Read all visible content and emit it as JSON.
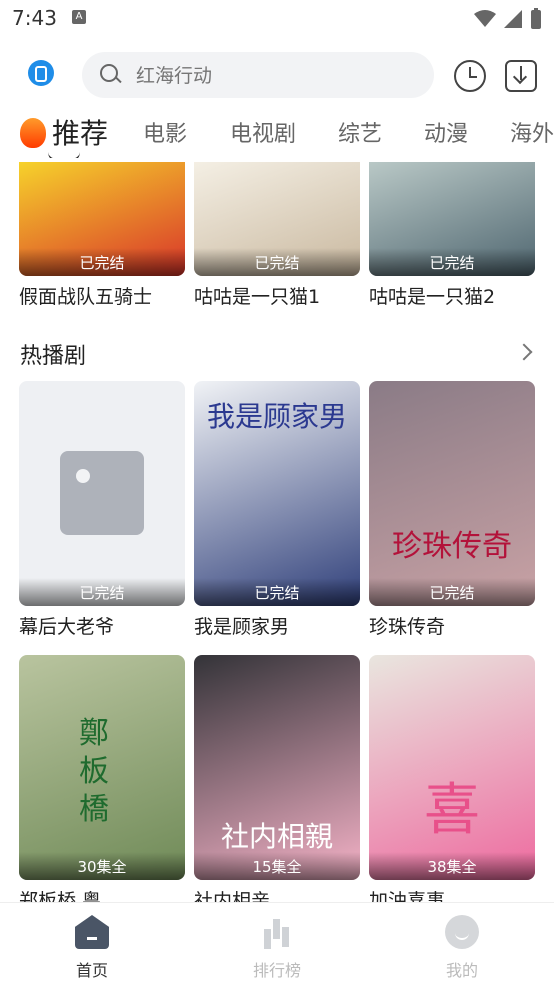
{
  "status_bar": {
    "time": "7:43",
    "notification_letter": "A"
  },
  "search": {
    "placeholder": "红海行动"
  },
  "tabs": [
    {
      "label": "推荐",
      "active": true
    },
    {
      "label": "电影"
    },
    {
      "label": "电视剧"
    },
    {
      "label": "综艺"
    },
    {
      "label": "动漫"
    },
    {
      "label": "海外"
    }
  ],
  "top_row": [
    {
      "title": "假面战队五骑士",
      "badge": "已完结",
      "colors": [
        "#f6d22b",
        "#d8332a"
      ]
    },
    {
      "title": "咕咕是一只猫1",
      "badge": "已完结",
      "colors": [
        "#f4efe4",
        "#c9b89f"
      ]
    },
    {
      "title": "咕咕是一只猫2",
      "badge": "已完结",
      "colors": [
        "#b9c8c6",
        "#4f6670"
      ]
    }
  ],
  "section": {
    "title": "热播剧"
  },
  "drama_row1": [
    {
      "title": "幕后大老爷",
      "badge": "已完结"
    },
    {
      "title": "我是顾家男",
      "badge": "已完结",
      "poster_text": "我是顾家男",
      "colors": [
        "#f1f3f6",
        "#2f3f7a"
      ]
    },
    {
      "title": "珍珠传奇",
      "badge": "已完结",
      "poster_text": "珍珠传奇",
      "colors": [
        "#8a7b86",
        "#c9a2a5"
      ]
    }
  ],
  "drama_row2": [
    {
      "title": "郑板桥 粤",
      "badge": "30集全",
      "poster_text": "鄭板橋",
      "colors": [
        "#b9c49f",
        "#6f8a57"
      ]
    },
    {
      "title": "社内相亲",
      "badge": "15集全",
      "poster_text": "社内相親",
      "colors": [
        "#333338",
        "#f6b3c8"
      ]
    },
    {
      "title": "加油喜事",
      "badge": "38集全",
      "poster_text": "喜",
      "colors": [
        "#e9e6df",
        "#ee6a9f"
      ]
    }
  ],
  "bottom_nav": [
    {
      "label": "首页",
      "active": true
    },
    {
      "label": "排行榜"
    },
    {
      "label": "我的"
    }
  ]
}
